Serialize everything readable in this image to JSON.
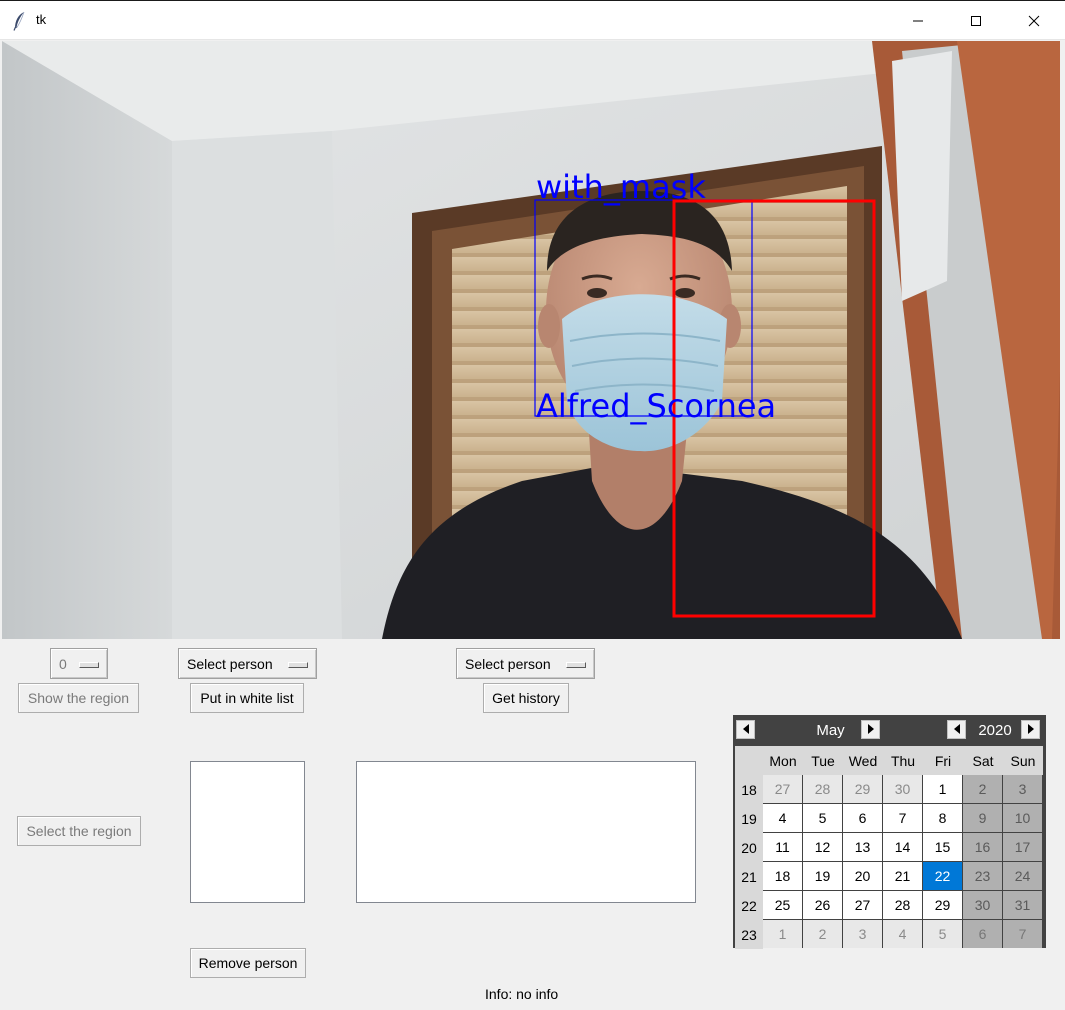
{
  "window": {
    "title": "tk",
    "icons": {
      "app": "feather-icon",
      "minimize": "minimize-icon",
      "maximize": "maximize-icon",
      "close": "close-icon"
    }
  },
  "video": {
    "detections": [
      {
        "label": "with_mask",
        "color": "#0000ff"
      },
      {
        "label": "Alfred_Scornea",
        "color": "#0000ff"
      }
    ],
    "red_box_color": "#ff0000"
  },
  "controls": {
    "camera_select": {
      "value": "0"
    },
    "show_region_button": "Show the region",
    "select_region_button": "Select the region",
    "person_select_1": {
      "value": "Select person"
    },
    "white_list_button": "Put in white list",
    "person_select_2": {
      "value": "Select person"
    },
    "get_history_button": "Get history",
    "remove_person_button": "Remove person",
    "info_text": "Info: no info"
  },
  "calendar": {
    "month": "May",
    "year": "2020",
    "weekdays": [
      "Mon",
      "Tue",
      "Wed",
      "Thu",
      "Fri",
      "Sat",
      "Sun"
    ],
    "weeks": [
      {
        "num": "18",
        "days": [
          "27",
          "28",
          "29",
          "30",
          "1",
          "2",
          "3"
        ]
      },
      {
        "num": "19",
        "days": [
          "4",
          "5",
          "6",
          "7",
          "8",
          "9",
          "10"
        ]
      },
      {
        "num": "20",
        "days": [
          "11",
          "12",
          "13",
          "14",
          "15",
          "16",
          "17"
        ]
      },
      {
        "num": "21",
        "days": [
          "18",
          "19",
          "20",
          "21",
          "22",
          "23",
          "24"
        ]
      },
      {
        "num": "22",
        "days": [
          "25",
          "26",
          "27",
          "28",
          "29",
          "30",
          "31"
        ]
      },
      {
        "num": "23",
        "days": [
          "1",
          "2",
          "3",
          "4",
          "5",
          "6",
          "7"
        ]
      }
    ],
    "selected_day": "22",
    "selected_color": "#0078d7"
  }
}
